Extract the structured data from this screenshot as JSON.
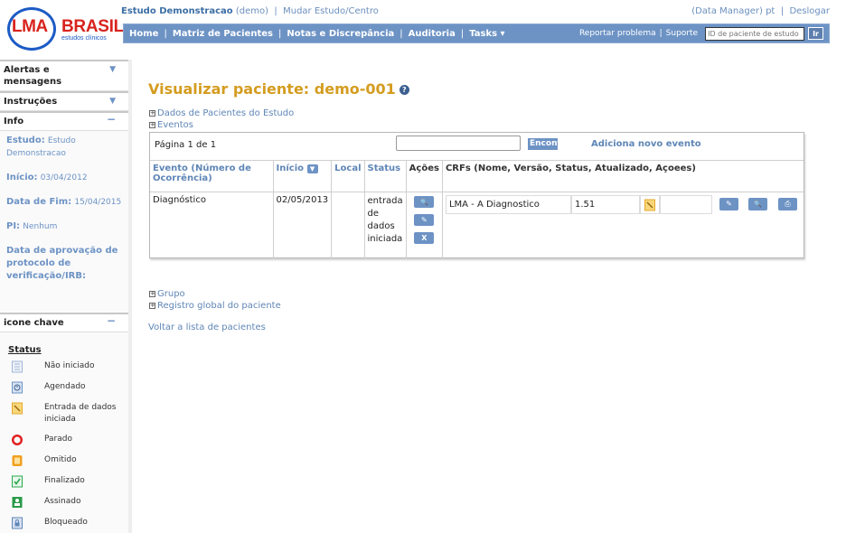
{
  "logo": {
    "lma": "LMA",
    "brasil": "BRASIL",
    "sub": "estudos clínicos"
  },
  "header": {
    "study_name": "Estudo Demonstracao",
    "study_code": "(demo)",
    "separator": "|",
    "change_study": "Mudar Estudo/Centro",
    "role": "(Data Manager)",
    "lang": "pt",
    "logout": "Deslogar"
  },
  "nav": {
    "items": [
      "Home",
      "Matriz de Pacientes",
      "Notas e Discrepância",
      "Auditoria",
      "Tasks ▾"
    ],
    "report": "Reportar problema",
    "support": "Suporte",
    "patient_id_placeholder": "ID de paciente de estudo",
    "go": "Ir"
  },
  "sidebar": {
    "alerts": "Alertas e mensagens",
    "instructions": "Instruções",
    "info": "Info",
    "toggle_down": "▼",
    "toggle_collapse": "−",
    "study_label": "Estudo:",
    "study_value": "Estudo Demonstracao",
    "start_label": "Início:",
    "start_value": "03/04/2012",
    "end_label": "Data de Fim:",
    "end_value": "15/04/2015",
    "pi_label": "PI:",
    "pi_value": "Nenhum",
    "approval_label": "Data de aprovação de protocolo de verificação/IRB:",
    "key_icons": "icone chave",
    "status_title": "Status",
    "legend": [
      {
        "label": "Não iniciado",
        "icon": "not-started-icon",
        "color": "#9fb5d6"
      },
      {
        "label": "Agendado",
        "icon": "scheduled-icon",
        "color": "#6d93c5"
      },
      {
        "label": "Entrada de dados iniciada",
        "icon": "data-entry-started-icon",
        "color": "#e6a82a"
      },
      {
        "label": "Parado",
        "icon": "stopped-icon",
        "color": "#e02020"
      },
      {
        "label": "Omitido",
        "icon": "skipped-icon",
        "color": "#f0a020"
      },
      {
        "label": "Finalizado",
        "icon": "completed-icon",
        "color": "#2aa84a"
      },
      {
        "label": "Assinado",
        "icon": "signed-icon",
        "color": "#2a9a4a"
      },
      {
        "label": "Bloqueado",
        "icon": "locked-icon",
        "color": "#5f86b6"
      }
    ]
  },
  "main": {
    "title": "Visualizar paciente: demo-001",
    "help_glyph": "?",
    "plus_glyph": "+",
    "study_data_link": "Dados de Pacientes do Estudo",
    "events_link": "Eventos",
    "pager": "Página 1 de 1",
    "find": "Encontrar",
    "add_event": "Adiciona novo evento",
    "columns": {
      "event": "Evento (Número de Ocorrência)",
      "start": "Início",
      "local": "Local",
      "status": "Status",
      "actions": "Ações",
      "crfs": "CRFs (Nome, Versão, Status, Atualizado, Açoees)"
    },
    "sort_glyph": "▼",
    "row": {
      "event": "Diagnóstico",
      "start": "02/05/2013",
      "local": "",
      "status": "entrada de dados iniciada",
      "action_view": "🔍",
      "action_edit": "✎",
      "action_delete": "X",
      "crf_name": "LMA - A Diagnostico",
      "crf_version": "1.51",
      "crf_updated": "",
      "crf_enter": "✎",
      "crf_view": "🔍",
      "crf_print": "⎙"
    },
    "group_link": "Grupo",
    "global_record_link": "Registro global do paciente",
    "back_link": "Voltar a lista de pacientes"
  }
}
